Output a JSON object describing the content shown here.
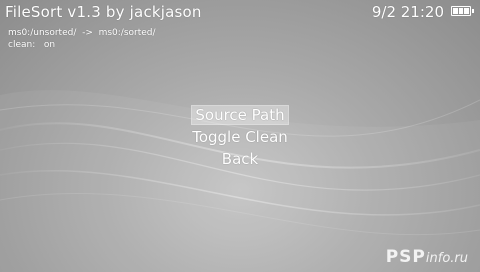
{
  "header": {
    "title": "FileSort v1.3 by jackjason",
    "clock": "9/2 21:20",
    "battery_level": 1.0
  },
  "info": {
    "path_line": "ms0:/unsorted/  ->  ms0:/sorted/",
    "clean_label": "clean:",
    "clean_value": "on"
  },
  "menu": {
    "items": [
      {
        "label": "Source Path",
        "selected": true
      },
      {
        "label": "Toggle Clean",
        "selected": false
      },
      {
        "label": "Back",
        "selected": false
      }
    ]
  },
  "watermark": {
    "brand": "PSP",
    "suffix": "info.ru"
  },
  "colors": {
    "text": "#ffffff",
    "background": "#a9a9a9"
  }
}
